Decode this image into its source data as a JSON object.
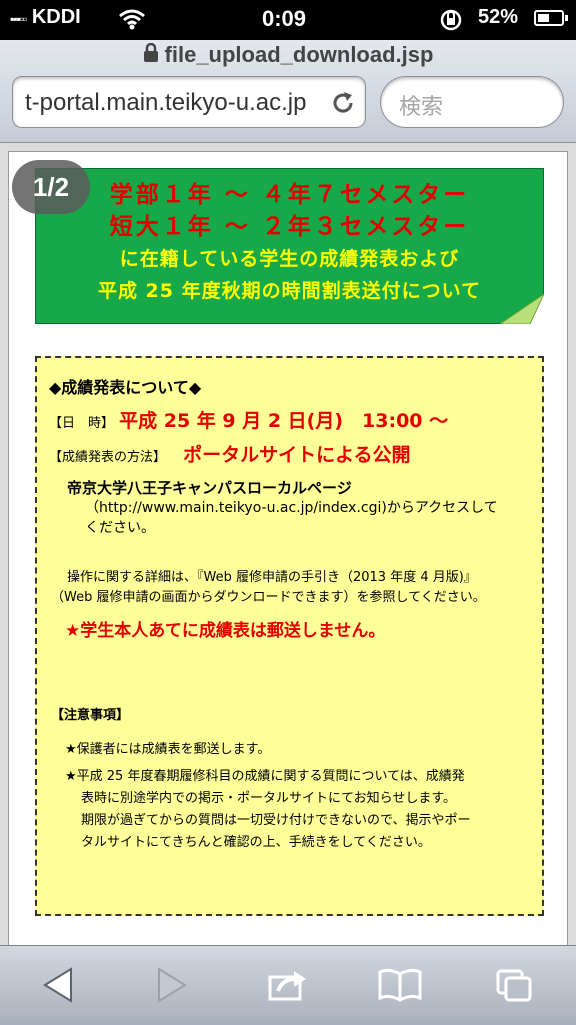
{
  "status": {
    "carrier": "KDDI",
    "time": "0:09",
    "battery": "52%",
    "battery_level": 0.52
  },
  "browser": {
    "title": "file_upload_download.jsp",
    "url": "t-portal.main.teikyo-u.ac.jp",
    "search_placeholder": "検索"
  },
  "page": {
    "indicator": "1/2",
    "banner": {
      "line1": "学部１年 〜 ４年７セメスター",
      "line2": "短大１年 〜 ２年３セメスター",
      "line3": "に在籍している学生の成績発表および",
      "line4": "平成 25 年度秋期の時間割表送付について"
    },
    "notice": {
      "heading": "◆成績発表について◆",
      "date_label": "【日　時】",
      "date_value": "平成 25 年 9 月 2 日(月)　13:00 〜",
      "method_label": "【成績発表の方法】",
      "method_value": "ポータルサイトによる公開",
      "site_name": "帝京大学八王子キャンパスローカルページ",
      "site_url": "（http://www.main.teikyo-u.ac.jp/index.cgi)からアクセスして",
      "site_tail": "ください。",
      "manual_line1": "操作に関する詳細は、『Web 履修申請の手引き（2013 年度 4 月版)』",
      "manual_line2": "（Web 履修申請の画面からダウンロードできます）を参照してください。",
      "warning": "★学生本人あてに成績表は郵送しません。",
      "caution_heading": "【注意事項】",
      "caution1": "★保護者には成績表を郵送します。",
      "caution2_line1": "★平成 25 年度春期履修科目の成績に関する質問については、成績発",
      "caution2_line2": "表時に別途学内での掲示・ポータルサイトにてお知らせします。",
      "caution2_line3": "期限が過ぎてからの質問は一切受け付けできないので、掲示やポー",
      "caution2_line4": "タルサイトにてきちんと確認の上、手続きをしてください。"
    }
  },
  "toolbar": {
    "icons": [
      "back-icon",
      "forward-icon",
      "share-icon",
      "bookmarks-icon",
      "tabs-icon"
    ]
  }
}
